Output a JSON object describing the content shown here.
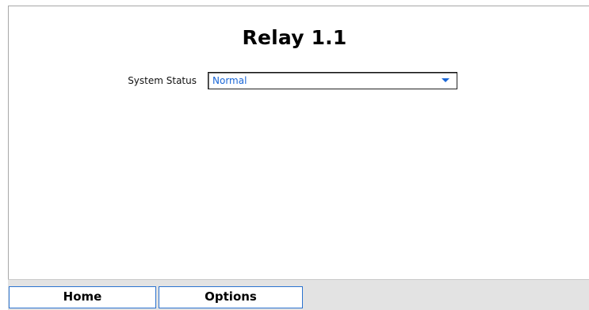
{
  "page": {
    "title": "Relay 1.1"
  },
  "system_status": {
    "label": "System Status",
    "value": "Normal"
  },
  "nav": {
    "home_label": "Home",
    "options_label": "Options"
  },
  "colors": {
    "accent": "#1a66d6",
    "button_border": "#2b73d0",
    "bar_background": "#e3e3e3"
  },
  "icons": {
    "dropdown": "chevron-down-icon"
  }
}
